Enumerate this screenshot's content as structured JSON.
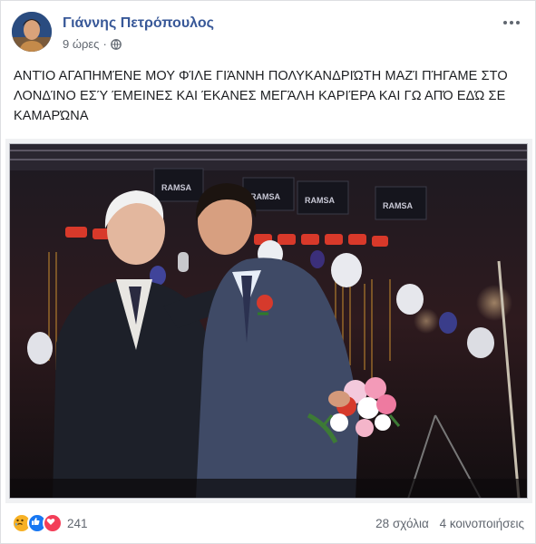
{
  "post": {
    "author": "Γιάννης Πετρόπουλος",
    "time": "9 ώρες",
    "separator": "·",
    "icons": {
      "audience": "globe-icon",
      "more": "more-options-icon"
    },
    "text": "ΑΝΤΊΟ ΑΓΑΠΗΜΈΝΕ ΜΟΥ ΦΊΛΕ ΓΙΆΝΝΗ ΠΟΛΥΚΑΝΔΡΙΏΤΗ ΜΑΖΊ ΠΉΓΑΜΕ ΣΤΟ ΛΟΝΔΊΝΟ ΕΣΎ ΈΜΕΙΝΕΣ ΚΑΙ ΈΚΑΝΕΣ ΜΕΓΆΛΗ ΚΑΡΙΈΡΑ ΚΑΙ ΓΩ ΑΠΌ ΕΔΏ ΣΕ ΚΑΜΑΡΏΝΑ",
    "photo": {
      "stage_labels": [
        "RAMSA",
        "RAMSA",
        "RAMSA",
        "RAMSA"
      ]
    }
  },
  "footer": {
    "reactions": [
      {
        "icon": "sad-icon",
        "color": "#f7b125"
      },
      {
        "icon": "like-icon",
        "color": "#1877f2"
      },
      {
        "icon": "love-icon",
        "color": "#f33e58"
      }
    ],
    "reaction_count": "241",
    "comments": "28 σχόλια",
    "shares": "4 κοινοποιήσεις"
  }
}
